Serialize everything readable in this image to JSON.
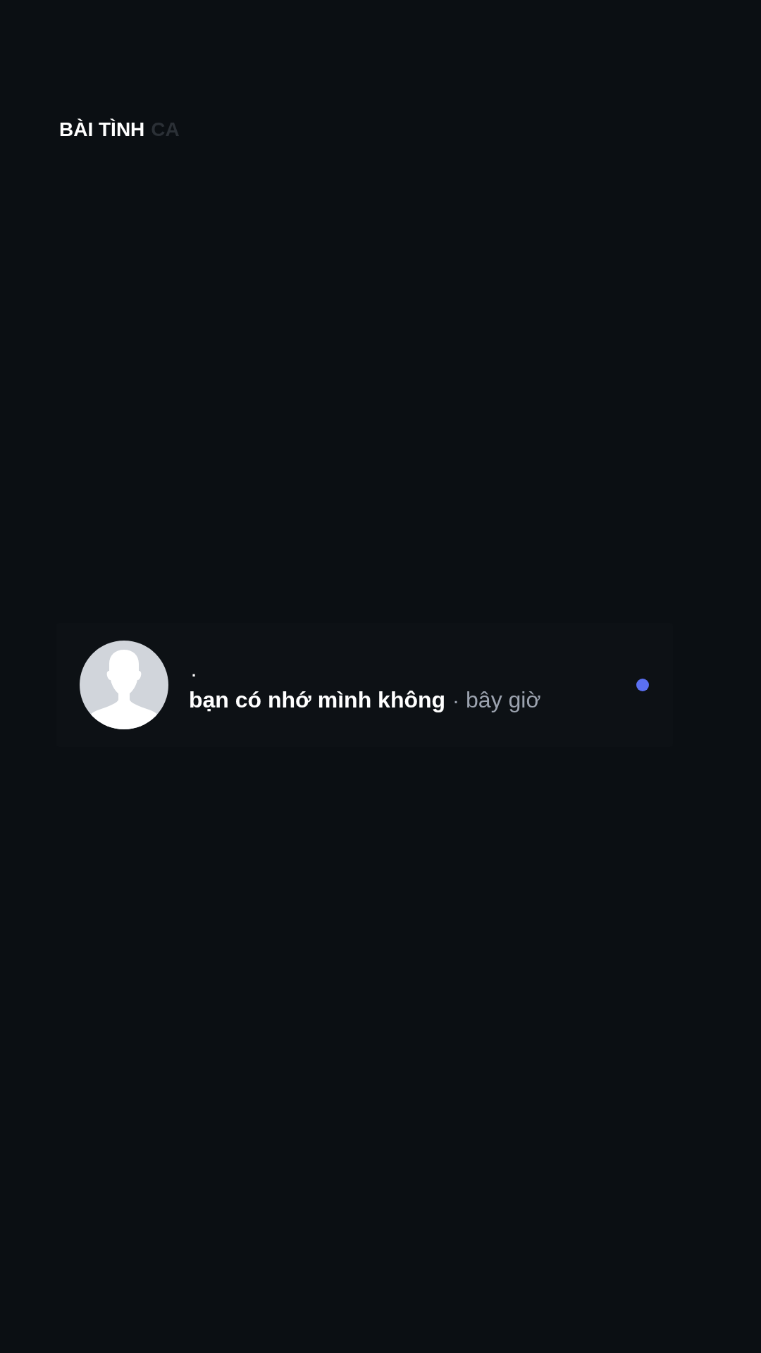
{
  "header": {
    "title": "BÀI TÌNH",
    "title_suffix": "CA"
  },
  "notifications": [
    {
      "sender": ".",
      "message": "bạn có nhớ mình không",
      "separator": "·",
      "time": "bây giờ",
      "unread": true
    }
  ]
}
